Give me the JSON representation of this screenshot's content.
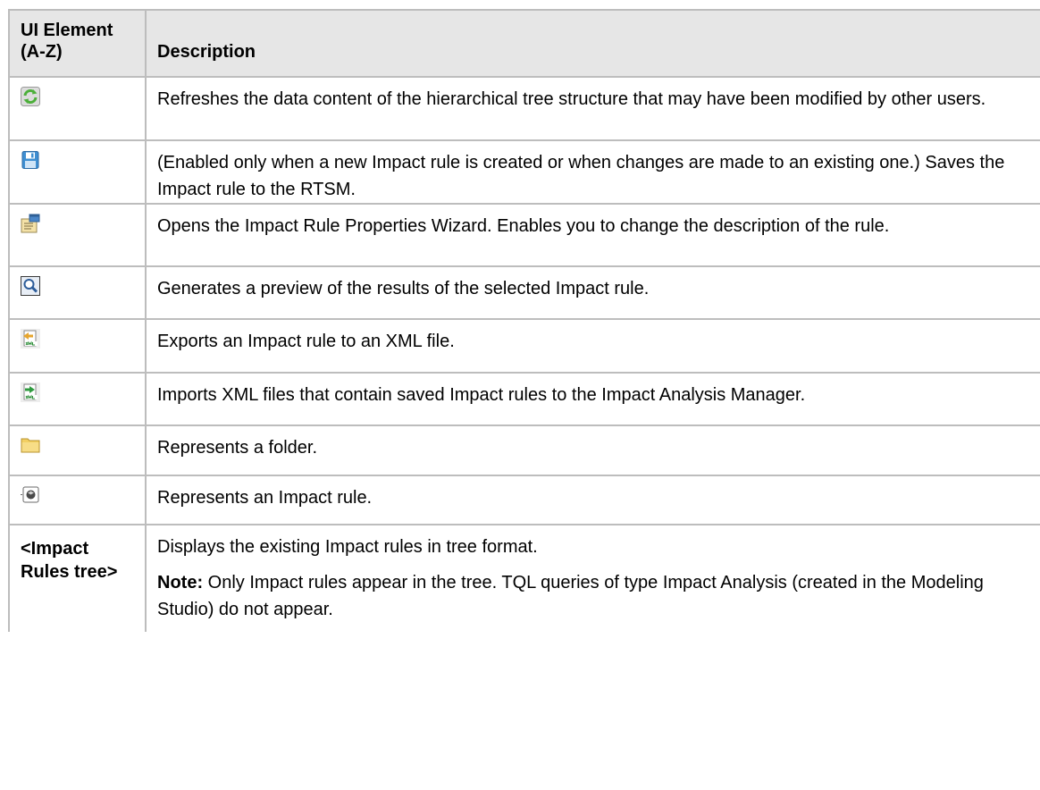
{
  "table": {
    "header": {
      "col1_line1": "UI Element",
      "col1_line2": "(A-Z)",
      "col2": "Description"
    },
    "rows": [
      {
        "icon": "refresh-icon",
        "description": "Refreshes the data content of the hierarchical tree structure that may have been modified by other users."
      },
      {
        "icon": "save-icon",
        "description": "(Enabled only when a new Impact rule is created or when changes are made to an existing one.) Saves the Impact rule to the RTSM."
      },
      {
        "icon": "properties-icon",
        "description": "Opens the Impact Rule Properties Wizard. Enables you to change the description of the rule."
      },
      {
        "icon": "preview-icon",
        "description": "Generates a preview of the results of the selected Impact rule."
      },
      {
        "icon": "export-xml-icon",
        "description": "Exports an Impact rule to an XML file."
      },
      {
        "icon": "import-xml-icon",
        "description": "Imports XML files that contain saved Impact rules to the Impact Analysis Manager."
      },
      {
        "icon": "folder-icon",
        "description": "Represents a folder."
      },
      {
        "icon": "impact-rule-icon",
        "description": "Represents an Impact rule."
      },
      {
        "label_line1": "<Impact",
        "label_line2": "Rules tree>",
        "description": "Displays the existing Impact rules in tree format.",
        "note_label": "Note:",
        "note_text": " Only Impact rules appear in the tree. TQL queries of type Impact Analysis (created in the Modeling Studio) do not appear."
      }
    ]
  },
  "colors": {
    "header_bg": "#e6e6e6",
    "border": "#bdbdbd",
    "refresh_green": "#4caf3a",
    "save_blue": "#3f8fd2",
    "folder_yellow": "#f2cf63"
  }
}
